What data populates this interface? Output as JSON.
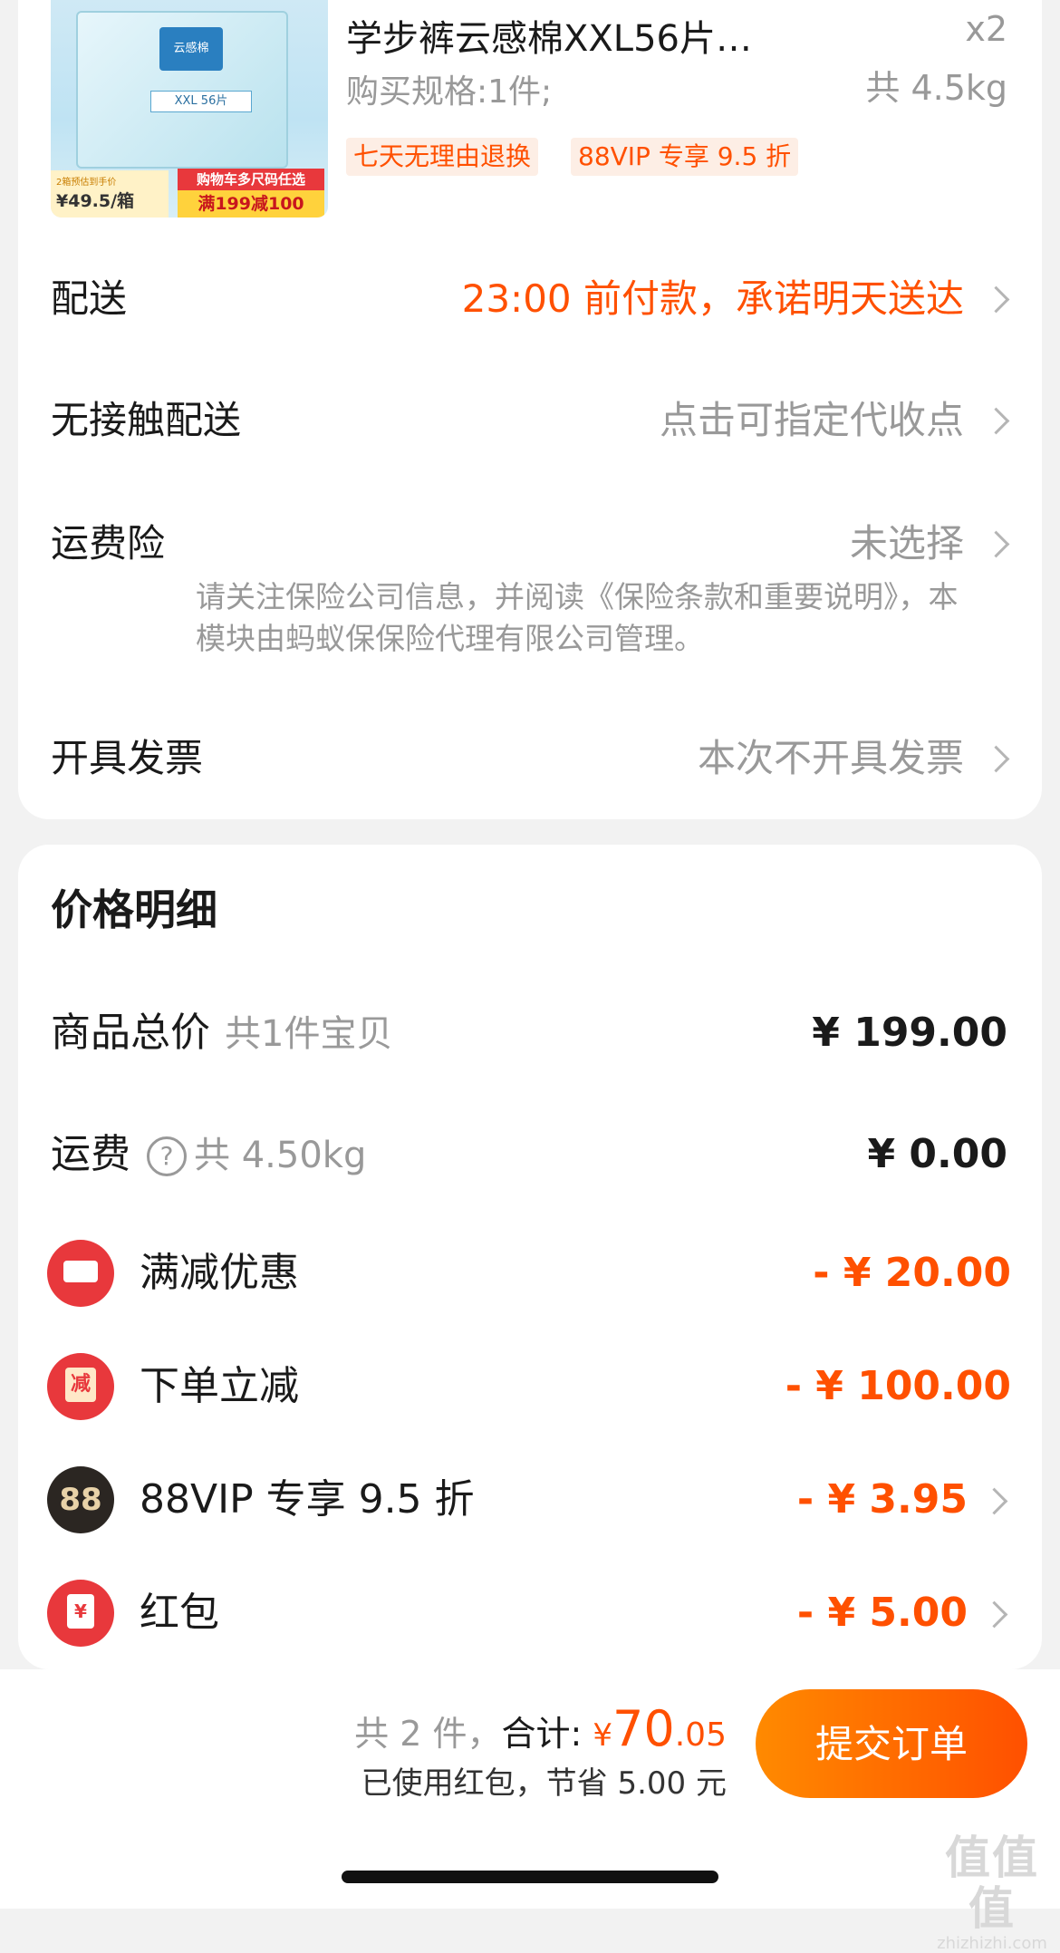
{
  "product": {
    "title": "学步裤云感棉XXL56片…",
    "quantity": "x2",
    "spec": "购买规格:1件;",
    "weight": "共 4.5kg",
    "tags": [
      "七天无理由退换",
      "88VIP 专享 9.5 折"
    ],
    "image": {
      "brand_label": "云感棉",
      "size_label": "XXL 56片",
      "promo_red": "购物车多尺码任选",
      "promo_yellow": "满199减100",
      "price_note": "2箱预估到手价",
      "price_tag": "¥49.5/箱"
    }
  },
  "delivery": {
    "label": "配送",
    "value": "23:00 前付款，承诺明天送达"
  },
  "contactless": {
    "label": "无接触配送",
    "value": "点击可指定代收点"
  },
  "insurance": {
    "label": "运费险",
    "value": "未选择",
    "note": "请关注保险公司信息，并阅读《保险条款和重要说明》，本模块由蚂蚁保保险代理有限公司管理。"
  },
  "invoice": {
    "label": "开具发票",
    "value": "本次不开具发票"
  },
  "price_detail": {
    "title": "价格明细",
    "goods": {
      "label": "商品总价",
      "sub": "共1件宝贝",
      "amount": "¥ 199.00"
    },
    "shipping": {
      "label": "运费",
      "help_icon": "?",
      "sub": "共 4.50kg",
      "amount": "¥ 0.00"
    },
    "discounts": [
      {
        "icon": "coupon-icon",
        "label": "满减优惠",
        "amount": "- ¥ 20.00"
      },
      {
        "icon": "reduce-icon",
        "icon_text": "减",
        "label": "下单立减",
        "amount": "- ¥ 100.00"
      },
      {
        "icon": "vip88-icon",
        "icon_text": "88",
        "label": "88VIP 专享 9.5 折",
        "amount": "- ¥ 3.95"
      },
      {
        "icon": "red-packet-icon",
        "icon_text": "¥",
        "label": "红包",
        "amount": "- ¥ 5.00"
      }
    ]
  },
  "bottom": {
    "count": "共 2 件，",
    "total_label": "合计:",
    "currency": "¥",
    "total_int": "70",
    "total_dec": ".05",
    "saved": "已使用红包，节省 5.00 元",
    "submit": "提交订单"
  },
  "watermark": {
    "big": "值值值",
    "small": "zhizhizhi.com"
  },
  "colors": {
    "accent": "#ff5000",
    "gray_text": "#999999",
    "red_icon": "#e8383c",
    "vip_icon": "#2b2622"
  }
}
